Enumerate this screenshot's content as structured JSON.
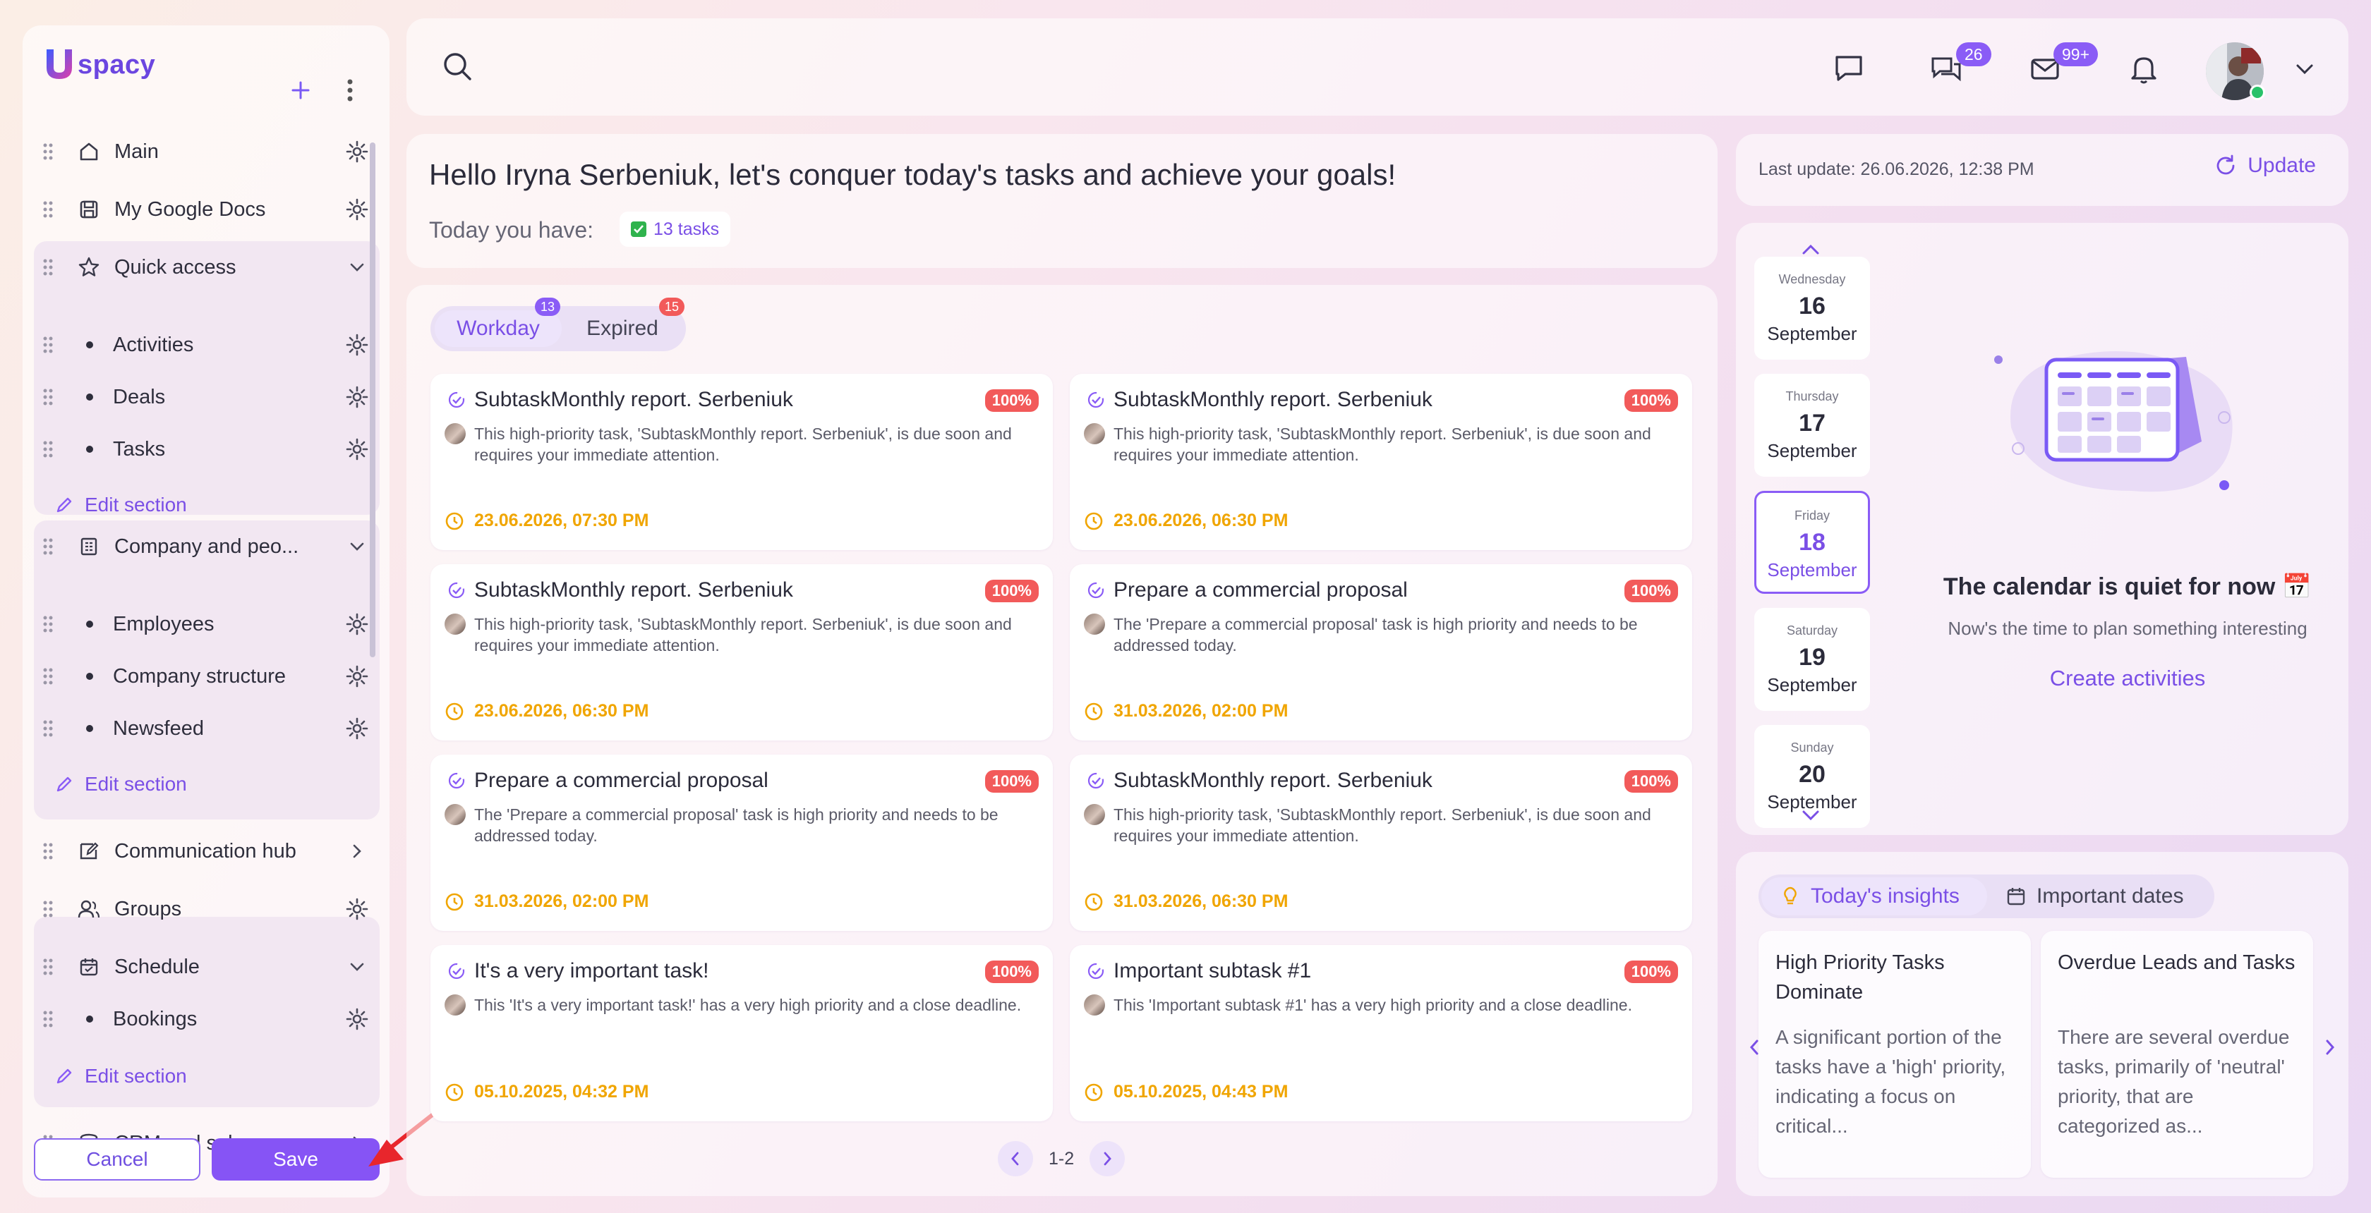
{
  "brand": {
    "logo_text": "spacy",
    "accent": "#8654f5"
  },
  "sidebar": {
    "items": [
      {
        "label": "Main",
        "icon": "home-icon"
      },
      {
        "label": "My Google Docs",
        "icon": "save-icon"
      },
      {
        "label": "Quick access",
        "icon": "star-icon"
      },
      {
        "label": "Activities"
      },
      {
        "label": "Deals"
      },
      {
        "label": "Tasks"
      },
      {
        "label": "Company and peo...",
        "icon": "building-icon"
      },
      {
        "label": "Employees"
      },
      {
        "label": "Company structure"
      },
      {
        "label": "Newsfeed"
      },
      {
        "label": "Communication hub",
        "icon": "chat-edit-icon"
      },
      {
        "label": "Groups",
        "icon": "users-icon"
      },
      {
        "label": "Schedule",
        "icon": "calendar-icon"
      },
      {
        "label": "Bookings"
      },
      {
        "label": "CRM and sales",
        "icon": "database-icon"
      }
    ],
    "edit_section_label": "Edit section",
    "cancel_label": "Cancel",
    "save_label": "Save"
  },
  "header": {
    "chat_badge": "26",
    "mail_badge": "99+"
  },
  "greeting": {
    "title": "Hello Iryna Serbeniuk, let's conquer today's tasks and achieve your goals!",
    "today_label": "Today you have:",
    "tasks_chip": "13 tasks"
  },
  "tasks_panel": {
    "tabs": [
      {
        "label": "Workday",
        "badge": "13"
      },
      {
        "label": "Expired",
        "badge": "15"
      }
    ],
    "cards": [
      {
        "title": "SubtaskMonthly report. Serbeniuk",
        "pct": "100%",
        "desc": "This high-priority task, 'SubtaskMonthly report. Serbeniuk', is due soon and requires your immediate attention.",
        "date": "23.06.2026, 07:30 PM"
      },
      {
        "title": "SubtaskMonthly report. Serbeniuk",
        "pct": "100%",
        "desc": "This high-priority task, 'SubtaskMonthly report. Serbeniuk', is due soon and requires your immediate attention.",
        "date": "23.06.2026, 06:30 PM"
      },
      {
        "title": "SubtaskMonthly report. Serbeniuk",
        "pct": "100%",
        "desc": "This high-priority task, 'SubtaskMonthly report. Serbeniuk', is due soon and requires your immediate attention.",
        "date": "23.06.2026, 06:30 PM"
      },
      {
        "title": "Prepare a commercial proposal",
        "pct": "100%",
        "desc": "The 'Prepare a commercial proposal' task is high priority and needs to be addressed today.",
        "date": "31.03.2026, 02:00 PM"
      },
      {
        "title": "Prepare a commercial proposal",
        "pct": "100%",
        "desc": "The 'Prepare a commercial proposal' task is high priority and needs to be addressed today.",
        "date": "31.03.2026, 02:00 PM"
      },
      {
        "title": "SubtaskMonthly report. Serbeniuk",
        "pct": "100%",
        "desc": "This high-priority task, 'SubtaskMonthly report. Serbeniuk', is due soon and requires your immediate attention.",
        "date": "31.03.2026, 06:30 PM"
      },
      {
        "title": "It's a very important task!",
        "pct": "100%",
        "desc": "This 'It's a very important task!' has a very high priority and a close deadline.",
        "date": "05.10.2025, 04:32 PM"
      },
      {
        "title": "Important subtask #1",
        "pct": "100%",
        "desc": "This 'Important subtask #1' has a very high priority and a close deadline.",
        "date": "05.10.2025, 04:43 PM"
      }
    ],
    "pager_text": "1-2"
  },
  "update": {
    "last_update": "Last update: 26.06.2026, 12:38 PM",
    "button_label": "Update"
  },
  "calendar": {
    "days": [
      {
        "weekday": "Wednesday",
        "day": "16",
        "month": "September"
      },
      {
        "weekday": "Thursday",
        "day": "17",
        "month": "September"
      },
      {
        "weekday": "Friday",
        "day": "18",
        "month": "September"
      },
      {
        "weekday": "Saturday",
        "day": "19",
        "month": "September"
      },
      {
        "weekday": "Sunday",
        "day": "20",
        "month": "September"
      }
    ],
    "empty_title": "The calendar is quiet for now 📅",
    "empty_sub": "Now's the time to plan something interesting",
    "create_label": "Create activities"
  },
  "insights": {
    "tabs": [
      "Today's insights",
      "Important dates"
    ],
    "cards": [
      {
        "title": "High Priority Tasks Dominate",
        "body": "A significant portion of the tasks have a 'high' priority, indicating a focus on critical..."
      },
      {
        "title": "Overdue Leads and Tasks",
        "body": "There are several overdue tasks, primarily of 'neutral' priority, that are categorized as..."
      }
    ]
  }
}
